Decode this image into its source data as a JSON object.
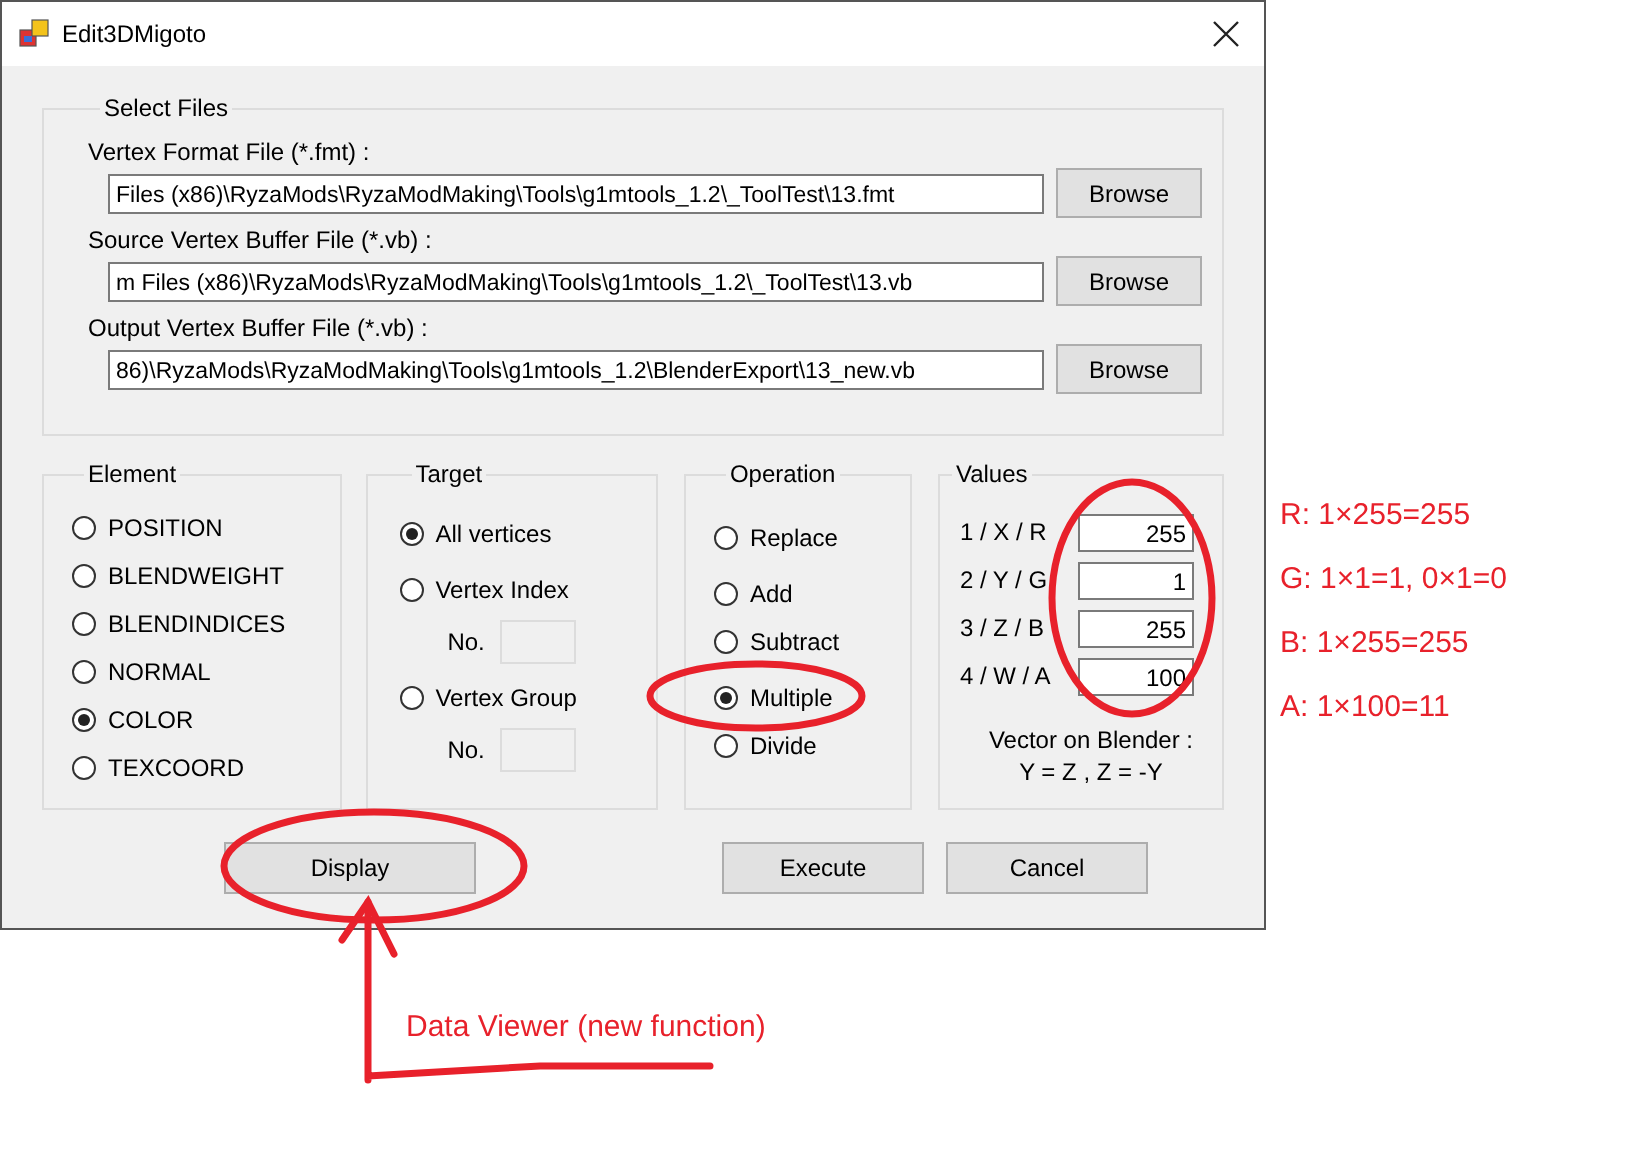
{
  "window": {
    "title": "Edit3DMigoto"
  },
  "select_files": {
    "title": "Select Files",
    "files": [
      {
        "label": "Vertex Format File (*.fmt) :",
        "value": "Files (x86)\\RyzaMods\\RyzaModMaking\\Tools\\g1mtools_1.2\\_ToolTest\\13.fmt",
        "button": "Browse"
      },
      {
        "label": "Source Vertex Buffer File (*.vb) :",
        "value": "m Files (x86)\\RyzaMods\\RyzaModMaking\\Tools\\g1mtools_1.2\\_ToolTest\\13.vb",
        "button": "Browse"
      },
      {
        "label": "Output Vertex Buffer File (*.vb) :",
        "value": "86)\\RyzaMods\\RyzaModMaking\\Tools\\g1mtools_1.2\\BlenderExport\\13_new.vb",
        "button": "Browse"
      }
    ]
  },
  "element": {
    "title": "Element",
    "options": [
      {
        "label": "POSITION",
        "selected": false
      },
      {
        "label": "BLENDWEIGHT",
        "selected": false
      },
      {
        "label": "BLENDINDICES",
        "selected": false
      },
      {
        "label": "NORMAL",
        "selected": false
      },
      {
        "label": "COLOR",
        "selected": true
      },
      {
        "label": "TEXCOORD",
        "selected": false
      }
    ]
  },
  "target": {
    "title": "Target",
    "options": [
      {
        "label": "All vertices",
        "selected": true
      },
      {
        "label": "Vertex Index",
        "selected": false,
        "number_label": "No."
      },
      {
        "label": "Vertex Group",
        "selected": false,
        "number_label": "No."
      }
    ]
  },
  "operation": {
    "title": "Operation",
    "options": [
      {
        "label": "Replace",
        "selected": false
      },
      {
        "label": "Add",
        "selected": false
      },
      {
        "label": "Subtract",
        "selected": false
      },
      {
        "label": "Multiple",
        "selected": true
      },
      {
        "label": "Divide",
        "selected": false
      }
    ]
  },
  "values": {
    "title": "Values",
    "rows": [
      {
        "label": "1 / X / R",
        "value": "255"
      },
      {
        "label": "2 / Y / G",
        "value": "1"
      },
      {
        "label": "3 / Z / B",
        "value": "255"
      },
      {
        "label": "4 / W / A",
        "value": "100"
      }
    ],
    "note": [
      "Vector on Blender :",
      "Y = Z , Z = -Y"
    ]
  },
  "buttons": {
    "display": "Display",
    "execute": "Execute",
    "cancel": "Cancel"
  },
  "annotations": {
    "formulas": [
      "R: 1×255=255",
      "G: 1×1=1, 0×1=0",
      "B: 1×255=255",
      "A: 1×100=11"
    ],
    "caption": "Data Viewer (new function)"
  }
}
